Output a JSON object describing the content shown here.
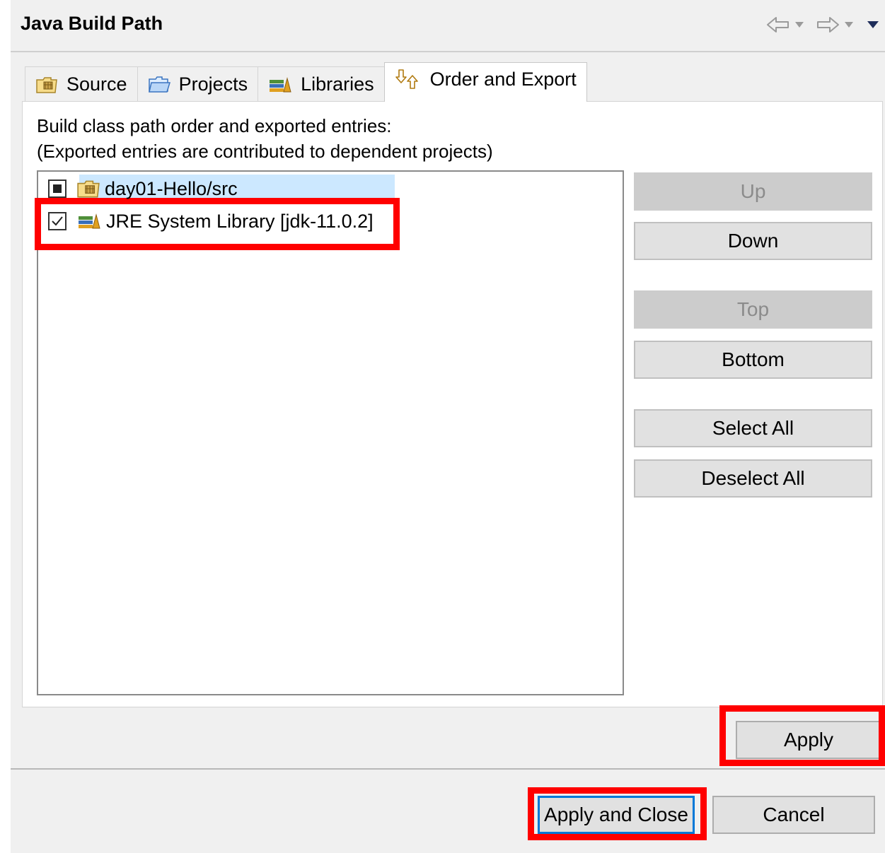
{
  "header": {
    "title": "Java Build Path",
    "nav": [
      "back-arrow-icon",
      "dropdown-icon",
      "forward-arrow-icon",
      "dropdown-icon",
      "view-menu-icon"
    ]
  },
  "tabs": [
    {
      "label": "Source",
      "icon": "source-folder-icon",
      "active": false
    },
    {
      "label": "Projects",
      "icon": "project-folder-icon",
      "active": false
    },
    {
      "label": "Libraries",
      "icon": "library-icon",
      "active": false
    },
    {
      "label": "Order and Export",
      "icon": "order-export-icon",
      "active": true
    }
  ],
  "panel": {
    "description_line1": "Build class path order and exported entries:",
    "description_line2": "(Exported entries are contributed to dependent projects)",
    "entries": [
      {
        "label": "day01-Hello/src",
        "icon": "source-folder-icon",
        "checked": "partial",
        "selected": true
      },
      {
        "label": "JRE System Library [jdk-11.0.2]",
        "icon": "library-icon",
        "checked": true,
        "selected": false
      }
    ],
    "buttons": {
      "up": "Up",
      "down": "Down",
      "top": "Top",
      "bottom": "Bottom",
      "select_all": "Select All",
      "deselect_all": "Deselect All"
    }
  },
  "footer": {
    "apply": "Apply",
    "apply_and_close": "Apply and Close",
    "cancel": "Cancel"
  },
  "colors": {
    "highlight": "#ff0000",
    "selection": "#cce8ff",
    "default_button_border": "#0078d7"
  }
}
